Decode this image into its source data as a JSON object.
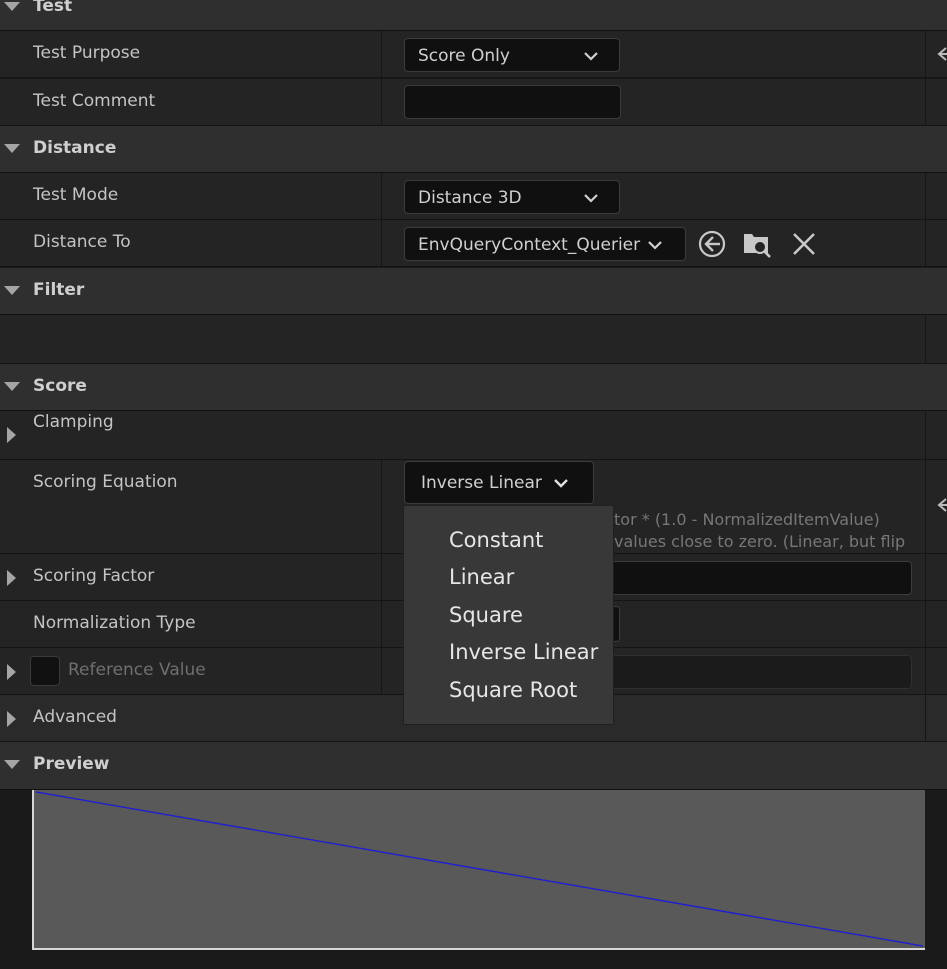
{
  "sections": {
    "test": "Test",
    "distance": "Distance",
    "filter": "Filter",
    "score": "Score",
    "preview": "Preview"
  },
  "test": {
    "purpose_label": "Test Purpose",
    "purpose_value": "Score Only",
    "comment_label": "Test Comment",
    "comment_value": ""
  },
  "distance": {
    "mode_label": "Test Mode",
    "mode_value": "Distance 3D",
    "to_label": "Distance To",
    "to_value": "EnvQueryContext_Querier"
  },
  "score": {
    "clamping_label": "Clamping",
    "equation_label": "Scoring Equation",
    "equation_value": "Inverse Linear",
    "equation_desc_line1": "tor * (1.0 - NormalizedItemValue)",
    "equation_desc_line2": "values close to zero.  (Linear, but flip",
    "factor_label": "Scoring Factor",
    "normalization_label": "Normalization Type",
    "reference_label": "Reference Value",
    "advanced_label": "Advanced"
  },
  "dropdown": {
    "options": [
      "Constant",
      "Linear",
      "Square",
      "Inverse Linear",
      "Square Root"
    ]
  },
  "chart_data": {
    "type": "line",
    "x": [
      0,
      1
    ],
    "series": [
      {
        "values": [
          1,
          0
        ]
      }
    ],
    "xlim": [
      0,
      1
    ],
    "ylim": [
      0,
      1
    ],
    "color": "#1e1ed2"
  },
  "colors": {
    "background": "#1a1a1a",
    "category": "#2f2f2f",
    "row": "#242424",
    "field": "#101010",
    "graph_bg": "#595959",
    "curve": "#1e1ed2"
  }
}
